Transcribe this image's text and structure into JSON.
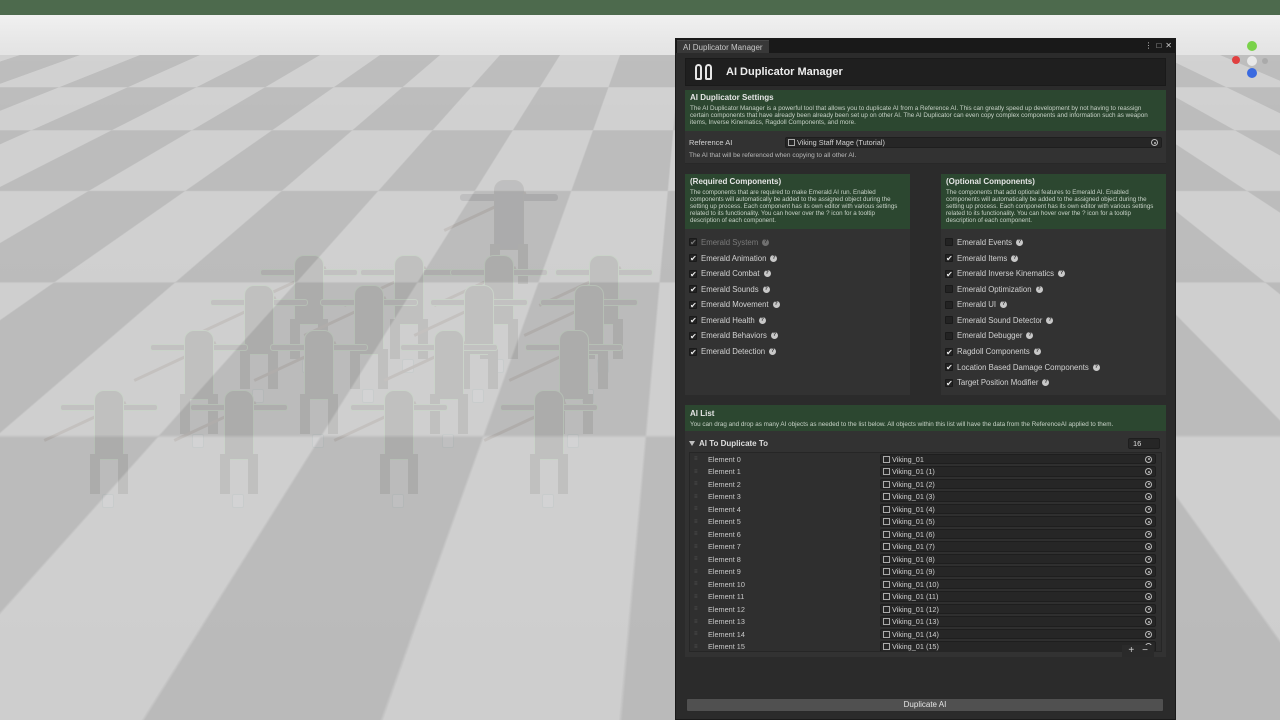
{
  "window": {
    "tab_title": "AI Duplicator Manager",
    "header_title": "AI Duplicator Manager",
    "controls": [
      "⋮",
      "□",
      "✕"
    ]
  },
  "settings": {
    "title": "AI Duplicator Settings",
    "description": "The AI Duplicator Manager is a powerful tool that allows you to duplicate AI from a Reference AI. This can greatly speed up development by not having to reassign certain components that have already been already been set up on other AI. The AI Duplicator can even copy complex components and information such as weapon items, Inverse Kinematics, Ragdoll Components, and more.",
    "reference_label": "Reference AI",
    "reference_value": "Viking Staff Mage (Tutorial)",
    "reference_desc": "The AI that will be referenced when copying to all other AI."
  },
  "required": {
    "title": "(Required Components)",
    "description": "The components that are required to make Emerald AI run. Enabled components will automatically be added to the assigned object during the setting up process. Each component has its own editor with various settings related to its functionality. You can hover over the ? icon for a tooltip description of each component.",
    "items": [
      {
        "label": "Emerald System",
        "checked": true,
        "disabled": true,
        "mark": "✔"
      },
      {
        "label": "Emerald Animation",
        "checked": true,
        "mark": "✔"
      },
      {
        "label": "Emerald Combat",
        "checked": true,
        "mark": "✔"
      },
      {
        "label": "Emerald Sounds",
        "checked": true,
        "mark": "✔"
      },
      {
        "label": "Emerald Movement",
        "checked": true,
        "mark": "✔"
      },
      {
        "label": "Emerald Health",
        "checked": true,
        "mark": "✔"
      },
      {
        "label": "Emerald Behaviors",
        "checked": true,
        "mark": "✔"
      },
      {
        "label": "Emerald Detection",
        "checked": true,
        "mark": "✔"
      }
    ]
  },
  "optional": {
    "title": "(Optional Components)",
    "description": "The components that add optional features to Emerald AI. Enabled components will automatically be added to the assigned object during the setting up process. Each component has its own editor with various settings related to its functionality. You can hover over the ? icon for a tooltip description of each component.",
    "items": [
      {
        "label": "Emerald Events",
        "checked": false,
        "mark": ""
      },
      {
        "label": "Emerald Items",
        "checked": true,
        "mark": "✔"
      },
      {
        "label": "Emerald Inverse Kinematics",
        "checked": true,
        "mark": "✔"
      },
      {
        "label": "Emerald Optimization",
        "checked": false,
        "mark": ""
      },
      {
        "label": "Emerald UI",
        "checked": false,
        "mark": ""
      },
      {
        "label": "Emerald Sound Detector",
        "checked": false,
        "mark": ""
      },
      {
        "label": "Emerald Debugger",
        "checked": false,
        "mark": ""
      },
      {
        "label": "Ragdoll Components",
        "checked": true,
        "mark": "✔"
      },
      {
        "label": "Location Based Damage Components",
        "checked": true,
        "mark": "✔"
      },
      {
        "label": "Target Position Modifier",
        "checked": true,
        "mark": "✔"
      }
    ]
  },
  "ai_list": {
    "title": "AI List",
    "description": "You can drag and drop as many AI objects as needed to the list below. All objects within this list will have the data from the ReferenceAI applied to them.",
    "array_label": "AI To Duplicate To",
    "size": "16",
    "elements": [
      {
        "label": "Element 0",
        "value": "Viking_01"
      },
      {
        "label": "Element 1",
        "value": "Viking_01 (1)"
      },
      {
        "label": "Element 2",
        "value": "Viking_01 (2)"
      },
      {
        "label": "Element 3",
        "value": "Viking_01 (3)"
      },
      {
        "label": "Element 4",
        "value": "Viking_01 (4)"
      },
      {
        "label": "Element 5",
        "value": "Viking_01 (5)"
      },
      {
        "label": "Element 6",
        "value": "Viking_01 (6)"
      },
      {
        "label": "Element 7",
        "value": "Viking_01 (7)"
      },
      {
        "label": "Element 8",
        "value": "Viking_01 (8)"
      },
      {
        "label": "Element 9",
        "value": "Viking_01 (9)"
      },
      {
        "label": "Element 10",
        "value": "Viking_01 (10)"
      },
      {
        "label": "Element 11",
        "value": "Viking_01 (11)"
      },
      {
        "label": "Element 12",
        "value": "Viking_01 (12)"
      },
      {
        "label": "Element 13",
        "value": "Viking_01 (13)"
      },
      {
        "label": "Element 14",
        "value": "Viking_01 (14)"
      },
      {
        "label": "Element 15",
        "value": "Viking_01 (15)"
      }
    ],
    "add_label": "+",
    "remove_label": "−"
  },
  "duplicate_button": "Duplicate AI",
  "colors": {
    "accent_green": "#2c4730",
    "panel": "#323232",
    "window": "#2b2b2b",
    "wireframe": "#9bf08c"
  }
}
